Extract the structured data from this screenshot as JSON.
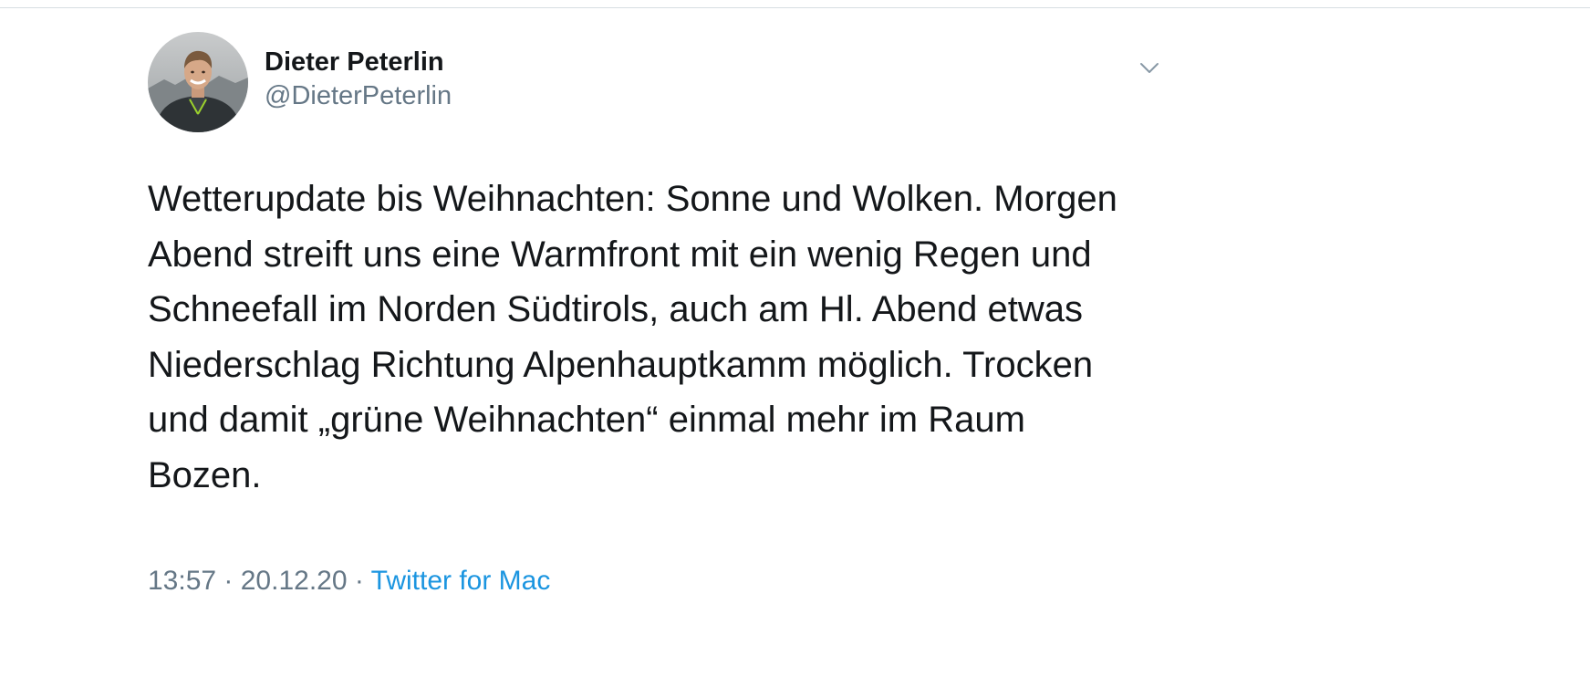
{
  "tweet": {
    "author": {
      "name": "Dieter Peterlin",
      "handle": "@DieterPeterlin"
    },
    "text": "Wetterupdate bis Weihnachten: Sonne und Wolken. Morgen\nAbend streift uns eine Warmfront mit ein wenig Regen und\nSchneefall im Norden Südtirols, auch am Hl. Abend etwas\nNiederschlag Richtung Alpenhauptkamm möglich. Trocken\nund damit „grüne Weihnachten“ einmal mehr im Raum\nBozen.",
    "meta": {
      "time": "13:57",
      "separator": " · ",
      "date": "20.12.20",
      "source": "Twitter for Mac"
    },
    "icons": {
      "menu": "chevron-down-icon"
    }
  },
  "colors": {
    "text": "#14171a",
    "secondary": "#657786",
    "link": "#1b95e0",
    "divider": "#d7dde2"
  }
}
